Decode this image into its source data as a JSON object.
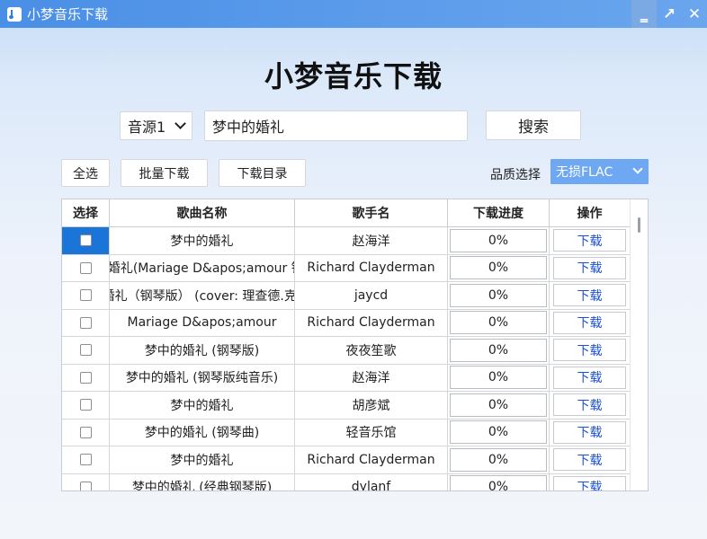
{
  "window": {
    "title": "小梦音乐下载",
    "controls": {
      "minimize": "‗",
      "maximize": "↗",
      "close": "✕"
    }
  },
  "header": {
    "title": "小梦音乐下载"
  },
  "search": {
    "source": "音源1",
    "value": "梦中的婚礼",
    "button": "搜索"
  },
  "toolbar": {
    "select_all": "全选",
    "batch_download": "批量下载",
    "download_dir": "下载目录",
    "quality_label": "品质选择",
    "quality_value": "无损FLAC"
  },
  "table": {
    "headers": [
      "选择",
      "歌曲名称",
      "歌手名",
      "下载进度",
      "操作"
    ],
    "rows": [
      {
        "title": "梦中的婚礼",
        "artist": "赵海洋",
        "progress": "0%",
        "action": "下载"
      },
      {
        "title": "梦中的婚礼(Mariage D&apos;amour 钢琴版)",
        "artist": "Richard Clayderman",
        "progress": "0%",
        "action": "下载"
      },
      {
        "title": "梦中的婚礼（钢琴版） (cover: 理查德.克莱德曼)",
        "artist": "jaycd",
        "progress": "0%",
        "action": "下载"
      },
      {
        "title": "Mariage D&apos;amour",
        "artist": "Richard Clayderman",
        "progress": "0%",
        "action": "下载"
      },
      {
        "title": "梦中的婚礼 (钢琴版)",
        "artist": "夜夜笙歌",
        "progress": "0%",
        "action": "下载"
      },
      {
        "title": "梦中的婚礼 (钢琴版纯音乐)",
        "artist": "赵海洋",
        "progress": "0%",
        "action": "下载"
      },
      {
        "title": "梦中的婚礼",
        "artist": "胡彦斌",
        "progress": "0%",
        "action": "下载"
      },
      {
        "title": "梦中的婚礼 (钢琴曲)",
        "artist": "轻音乐馆",
        "progress": "0%",
        "action": "下载"
      },
      {
        "title": "梦中的婚礼",
        "artist": "Richard Clayderman",
        "progress": "0%",
        "action": "下载"
      },
      {
        "title": "梦中的婚礼 (经典钢琴版)",
        "artist": "dylanf",
        "progress": "0%",
        "action": "下载"
      }
    ]
  }
}
